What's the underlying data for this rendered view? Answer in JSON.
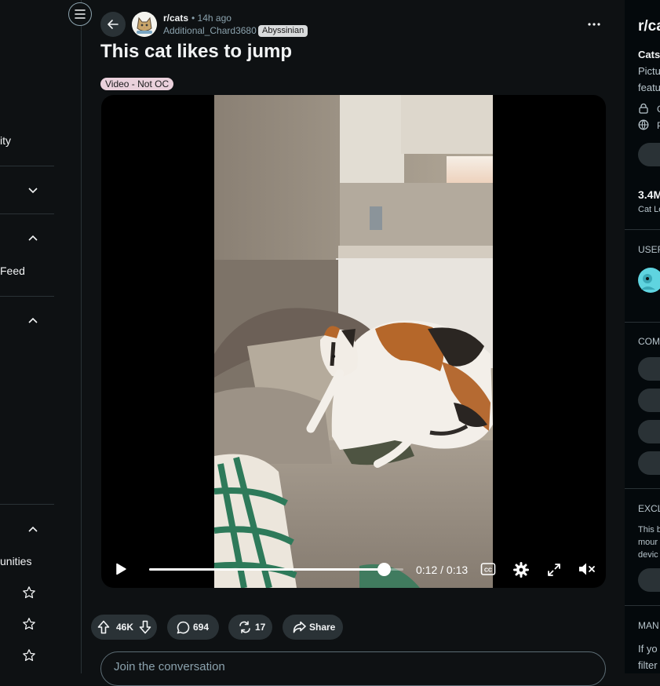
{
  "left_sidebar": {
    "item_community": "ity",
    "item_feed": "Feed",
    "item_communities": "unities"
  },
  "post": {
    "subreddit": "r/cats",
    "separator": "•",
    "time_ago": "14h ago",
    "author": "Additional_Chard3680",
    "user_flair": "Abyssinian",
    "title": "This cat likes to jump",
    "post_flair": "Video - Not OC"
  },
  "video": {
    "time_display": "0:12 / 0:13",
    "progress": 0.9231
  },
  "actions": {
    "votes": "46K",
    "comments": "694",
    "crossposts": "17",
    "share": "Share"
  },
  "comment_box": {
    "placeholder": "Join the conversation"
  },
  "right_sidebar": {
    "title": "r/ca",
    "desc_bold": "Cats",
    "desc_line1": "Pictu",
    "desc_line2": "featu",
    "row1": "C",
    "row2": "P",
    "members": "3.4M",
    "members_label": "Cat Lo",
    "heading_user": "USER",
    "heading_community": "COM",
    "heading_exclusive": "EXCLU",
    "excl_line1": "This b",
    "excl_line2": "mour",
    "excl_line3": "devic",
    "heading_manage": "MAN",
    "manage_line1": "If yo",
    "manage_line2": "filter"
  },
  "colors": {
    "background": "#0e1113",
    "sidebar_background": "#04090c",
    "pill_background": "#2a3236",
    "muted_text": "#8ba2ad",
    "post_flair_bg": "#ead1dc",
    "user_flair_bg": "#d9dbdc"
  },
  "icons": [
    "menu-icon",
    "back-arrow-icon",
    "more-options-icon",
    "play-icon",
    "captions-icon",
    "settings-icon",
    "fullscreen-icon",
    "mute-icon",
    "upvote-icon",
    "downvote-icon",
    "comment-icon",
    "crosspost-icon",
    "share-icon",
    "chevron-down-icon",
    "chevron-up-icon",
    "star-icon",
    "lock-icon",
    "globe-icon"
  ]
}
